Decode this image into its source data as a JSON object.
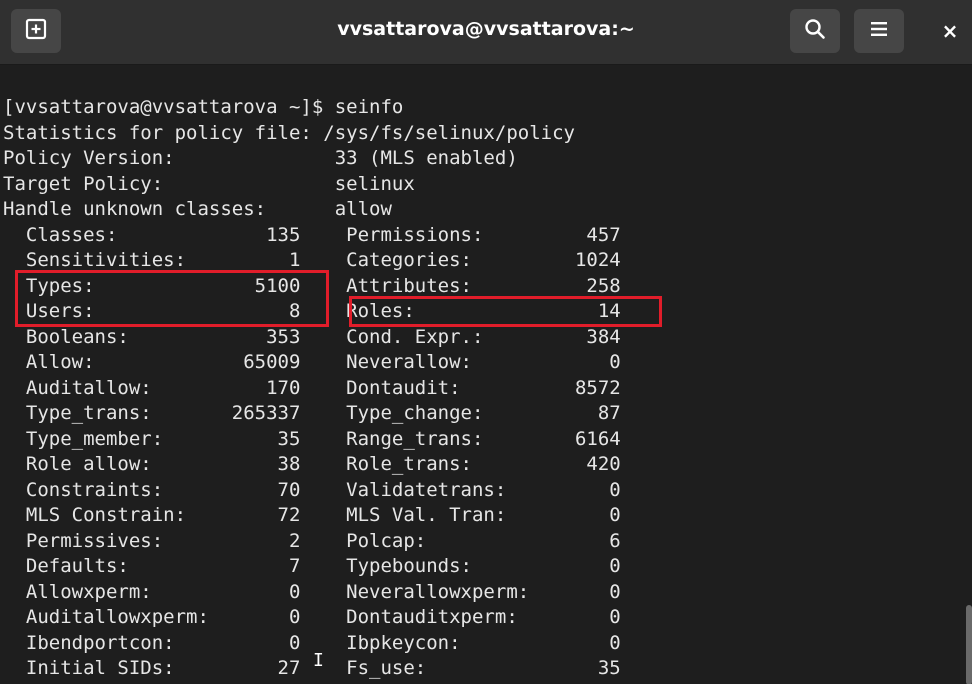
{
  "window": {
    "title": "vvsattarova@vvsattarova:~",
    "new_tab_icon": "new-tab-icon",
    "search_icon": "search-icon",
    "menu_icon": "hamburger-menu-icon",
    "close_label": "×"
  },
  "terminal": {
    "lines": [
      "[vvsattarova@vvsattarova ~]$ seinfo",
      "Statistics for policy file: /sys/fs/selinux/policy",
      "Policy Version:              33 (MLS enabled)",
      "Target Policy:               selinux",
      "Handle unknown classes:      allow",
      "  Classes:             135    Permissions:         457",
      "  Sensitivities:         1    Categories:         1024",
      "  Types:              5100    Attributes:          258",
      "  Users:                 8    Roles:                14",
      "  Booleans:            353    Cond. Expr.:         384",
      "  Allow:             65009    Neverallow:            0",
      "  Auditallow:          170    Dontaudit:          8572",
      "  Type_trans:       265337    Type_change:          87",
      "  Type_member:          35    Range_trans:        6164",
      "  Role allow:           38    Role_trans:          420",
      "  Constraints:          70    Validatetrans:         0",
      "  MLS Constrain:        72    MLS Val. Tran:         0",
      "  Permissives:           2    Polcap:                6",
      "  Defaults:              7    Typebounds:            0",
      "  Allowxperm:            0    Neverallowxperm:       0",
      "  Auditallowxperm:       0    Dontauditxperm:        0",
      "  Ibendportcon:          0    Ibpkeycon:             0",
      "  Initial SIDs:         27    Fs_use:               35"
    ]
  },
  "colors": {
    "highlight_box": "#e11d2a",
    "terminal_bg": "#1e1e1e",
    "titlebar_bg": "#303030"
  }
}
